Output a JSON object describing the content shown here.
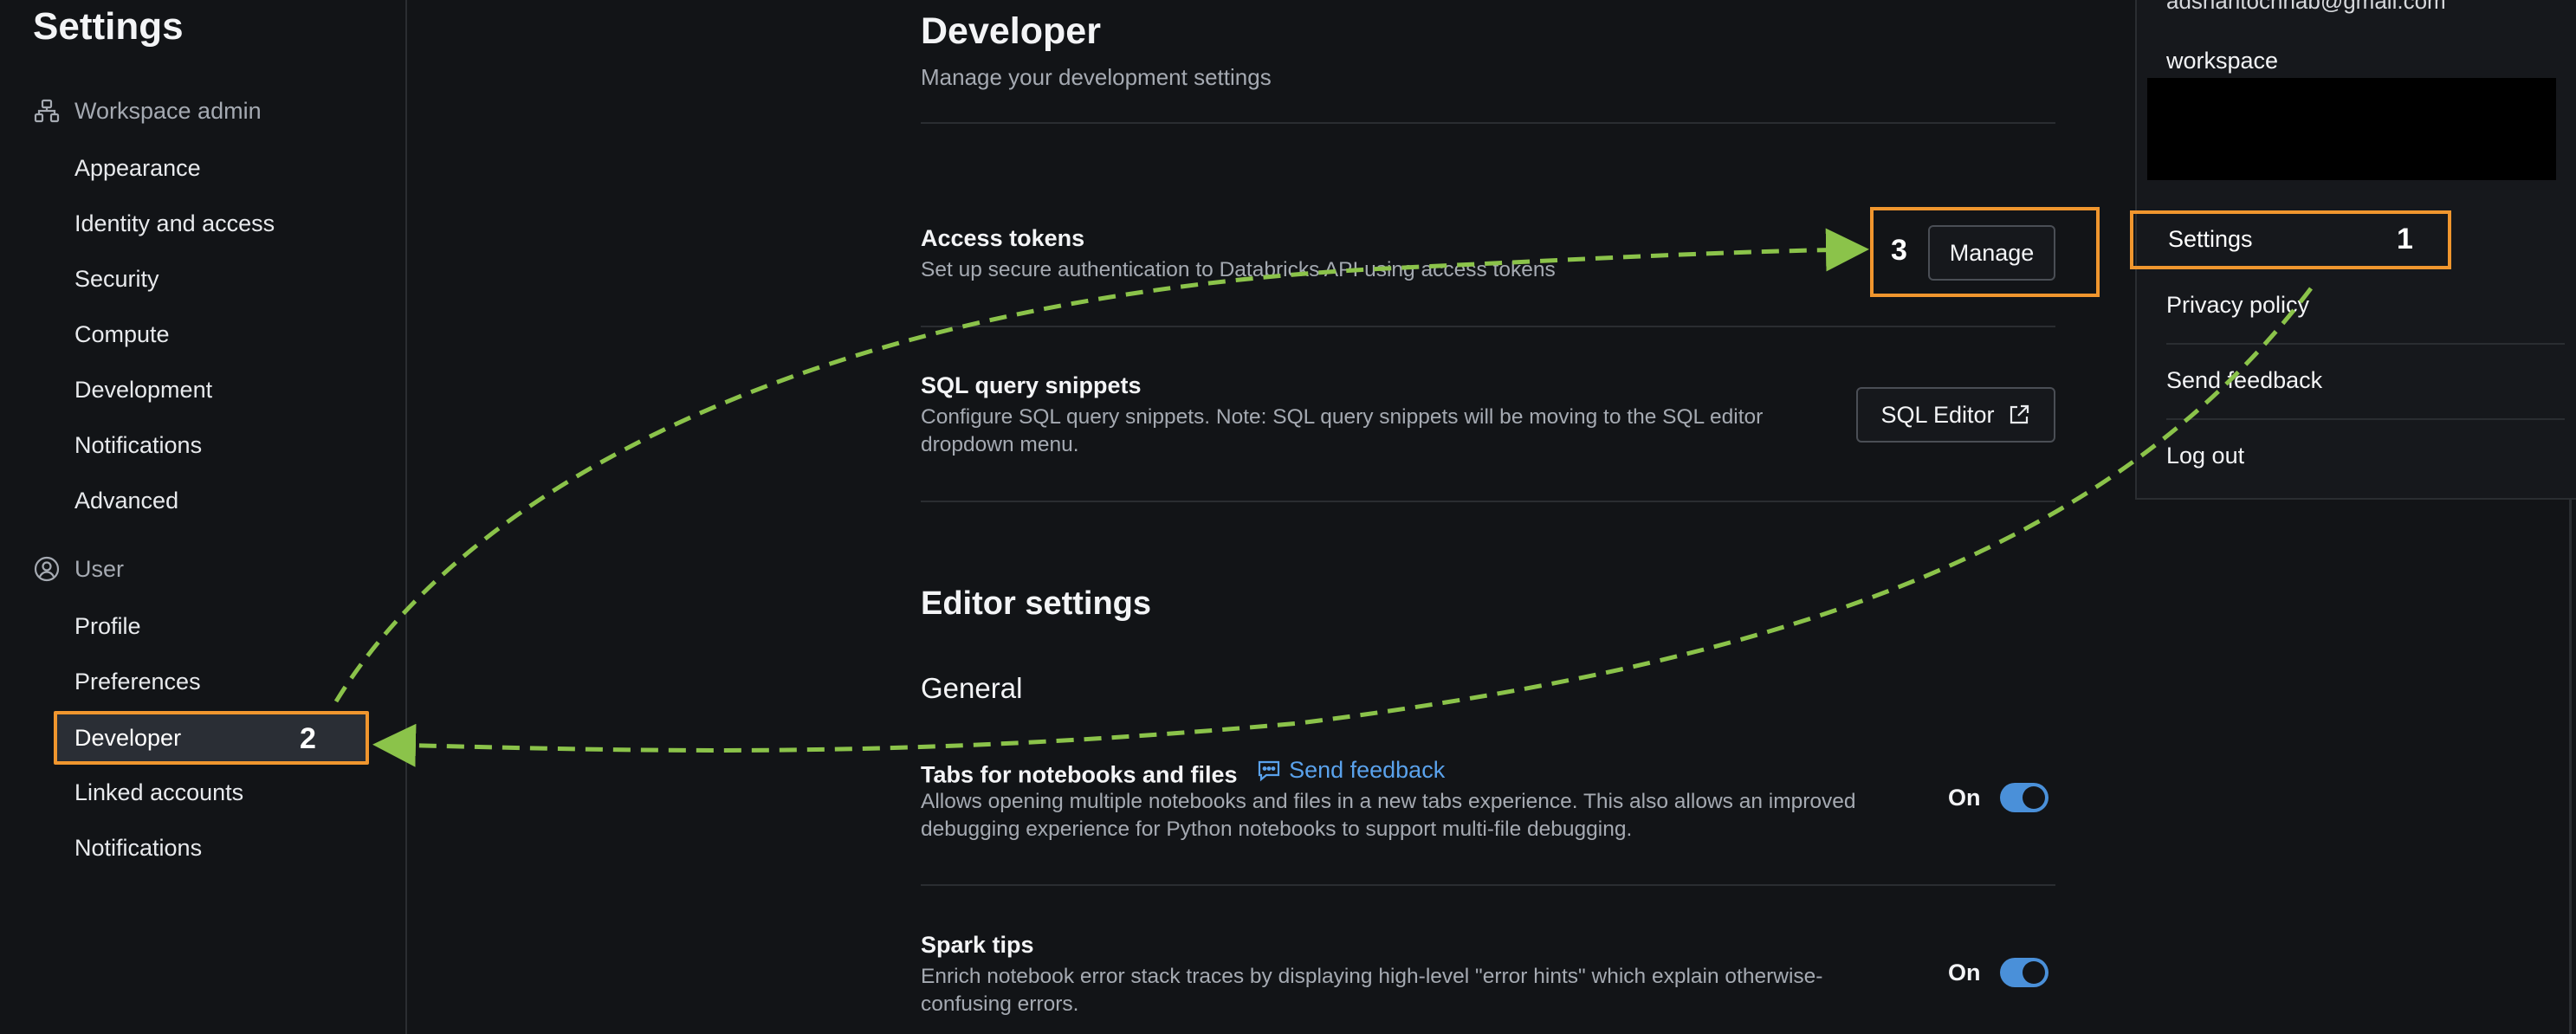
{
  "sidebar": {
    "title": "Settings",
    "workspace_section": "Workspace admin",
    "workspace_items": [
      "Appearance",
      "Identity and access",
      "Security",
      "Compute",
      "Development",
      "Notifications",
      "Advanced"
    ],
    "user_section": "User",
    "user_items": [
      "Profile",
      "Preferences",
      "Developer",
      "Linked accounts",
      "Notifications"
    ],
    "developer_step": "2"
  },
  "main": {
    "title": "Developer",
    "subtitle": "Manage your development settings",
    "access_tokens": {
      "title": "Access tokens",
      "desc": "Set up secure authentication to Databricks API using access tokens",
      "button": "Manage",
      "step": "3"
    },
    "sql_snippets": {
      "title": "SQL query snippets",
      "desc": "Configure SQL query snippets. Note: SQL query snippets will be moving to the SQL editor dropdown menu.",
      "button": "SQL Editor"
    },
    "editor_settings": "Editor settings",
    "general": "General",
    "tabs_setting": {
      "title": "Tabs for notebooks and files",
      "feedback": "Send feedback",
      "desc": "Allows opening multiple notebooks and files in a new tabs experience. This also allows an improved debugging experience for Python notebooks to support multi-file debugging.",
      "state": "On"
    },
    "spark_tips": {
      "title": "Spark tips",
      "desc": "Enrich notebook error stack traces by displaying high-level \"error hints\" which explain otherwise-confusing errors.",
      "state": "On"
    }
  },
  "dropdown": {
    "email": "adsnantochhab@gmail.com",
    "workspace": "workspace",
    "settings": "Settings",
    "settings_step": "1",
    "privacy": "Privacy policy",
    "feedback": "Send feedback",
    "logout": "Log out"
  },
  "colors": {
    "background": "#121417",
    "highlight": "#f0962e",
    "arrow": "#8bc34a",
    "toggle": "#4a90d9",
    "link": "#5aa2ec"
  }
}
